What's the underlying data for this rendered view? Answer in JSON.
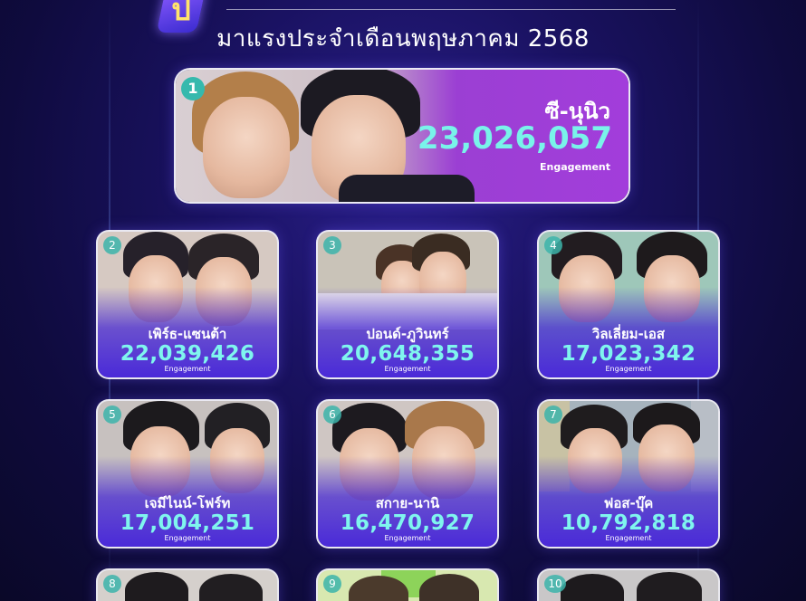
{
  "header": {
    "logo_glyph": "ป",
    "subtitle": "มาแรงประจำเดือนพฤษภาคม 2568"
  },
  "featured": {
    "rank": "1",
    "name": "ซี-นุนิว",
    "value": "23,026,057",
    "metric": "Engagement"
  },
  "cards": [
    {
      "rank": "2",
      "name": "เพิร์ธ-แซนต้า",
      "value": "22,039,426",
      "metric": "Engagement"
    },
    {
      "rank": "3",
      "name": "ปอนด์-ภูวินทร์",
      "value": "20,648,355",
      "metric": "Engagement"
    },
    {
      "rank": "4",
      "name": "วิลเลี่ยม-เอส",
      "value": "17,023,342",
      "metric": "Engagement"
    },
    {
      "rank": "5",
      "name": "เจมีไนน์-โฟร์ท",
      "value": "17,004,251",
      "metric": "Engagement"
    },
    {
      "rank": "6",
      "name": "สกาย-นานิ",
      "value": "16,470,927",
      "metric": "Engagement"
    },
    {
      "rank": "7",
      "name": "ฟอส-บุ๊ค",
      "value": "10,792,818",
      "metric": "Engagement"
    },
    {
      "rank": "8"
    },
    {
      "rank": "9"
    },
    {
      "rank": "10"
    }
  ],
  "colors": {
    "background": "#1a1262",
    "accent_number": "#7ff5ee",
    "rank_badge": "#35b9ad",
    "card_shade": "#4a2ad8"
  }
}
